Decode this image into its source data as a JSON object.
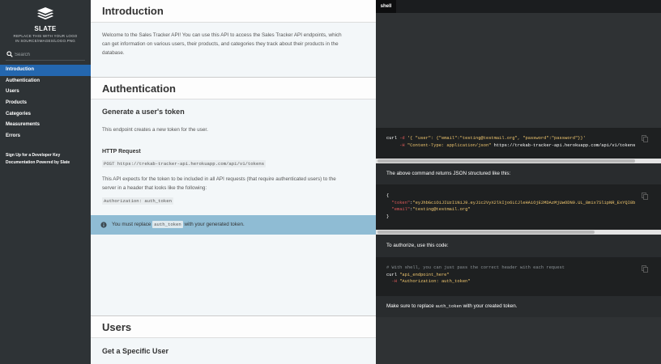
{
  "sidebar": {
    "logo_title": "SLATE",
    "logo_sub_line1": "REPLACE THIS WITH YOUR LOGO",
    "logo_sub_line2": "IN SOURCE/IMAGES/LOGO.PNG",
    "search_placeholder": "Search",
    "toc": [
      {
        "label": "Introduction"
      },
      {
        "label": "Authentication"
      },
      {
        "label": "Users"
      },
      {
        "label": "Products"
      },
      {
        "label": "Categories"
      },
      {
        "label": "Measurements"
      },
      {
        "label": "Errors"
      }
    ],
    "footer": {
      "line1": "Sign Up for a Developer Key",
      "line2": "Documentation Powered by Slate"
    },
    "colors": {
      "background": "#2e3336",
      "active": "#2467af"
    }
  },
  "content": {
    "intro": {
      "title": "Introduction",
      "para_line1": "Welcome to the Sales Tracker API! You can use this API to access the Sales Tracker API endpoints, which",
      "para_line2": "can get information on various users, their products, and categories they track about their products in the",
      "para_line3": "database."
    },
    "auth": {
      "title": "Authentication",
      "subtitle": "Generate a user's token",
      "para": "This endpoint creates a new token for the user.",
      "http_heading": "HTTP Request",
      "http_request": "POST https://trekab-tracker-api.herokuapp.com/api/v1/tokens",
      "para2_line1": "This API expects for the token to be included in all API requests (that require authenticated users) to the",
      "para2_line2": "server in a header that looks like the following:",
      "header_example": "Authorization: auth_token",
      "notice_pre": "You must replace ",
      "notice_code": "auth_token",
      "notice_post": " with your generated token."
    },
    "users": {
      "title": "Users",
      "subtitle": "Get a Specific User"
    }
  },
  "dark": {
    "lang_tab": "shell",
    "curl1": {
      "l1_a": "curl ",
      "l1_b": "-d ",
      "l1_c": "'{ \"user\": {\"email\":\"testing@testmail.org\", \"password\":\"password\"}}'",
      "l2_a": "     -H ",
      "l2_b": "\"Content-Type: application/json\"",
      "l2_c": " https://trekab-tracker-api.herokuapp.com/api/v1/tokens"
    },
    "json_note": "The above command returns JSON structured like this:",
    "json": {
      "open": "{",
      "token_key": "\"token\"",
      "token_val": "\"eyJhbGciOiJIUzI1NiJ9.eyJ1c2VyX2lkIjo6LCJleHAiOjE2MDAzMjUwODN9.UL_8mix7SlipNR_ExYQI8b",
      "email_key": "\"email\"",
      "email_val": "\"testing@testmail.org\"",
      "close": "}"
    },
    "authorize_note": "To authorize, use this code:",
    "curl2": {
      "comment": "# With shell, you can just pass the correct header with each request",
      "l2_a": "curl ",
      "l2_b": "\"api_endpoint_here\"",
      "l3_a": "  -H ",
      "l3_b": "\"Authorization: auth_token\""
    },
    "replace_pre": "Make sure to replace ",
    "replace_code": "auth_token",
    "replace_post": " with your created token.",
    "colors": {
      "pane": "#2f3234",
      "code": "#1e2021",
      "string": "#f0c66e",
      "flag": "#e05a5a"
    }
  }
}
